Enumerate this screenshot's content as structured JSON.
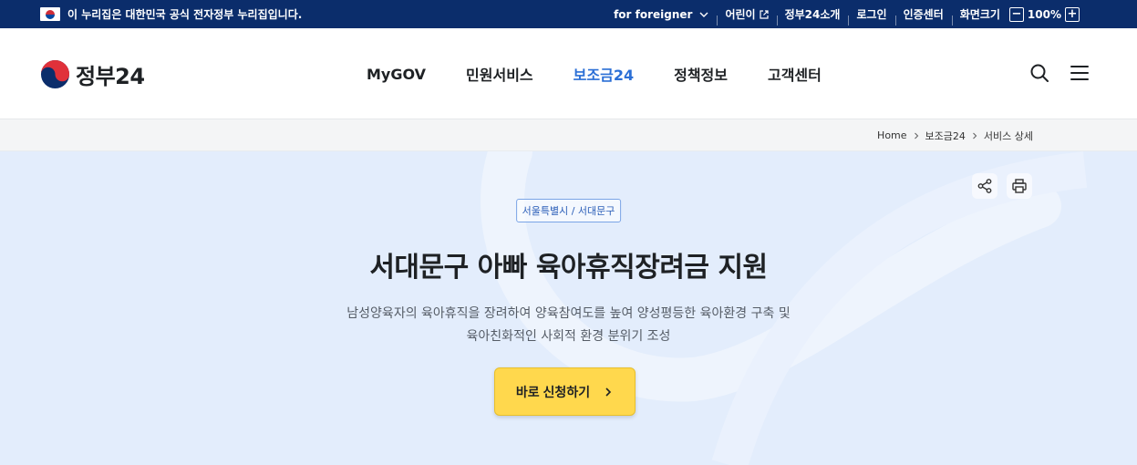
{
  "gov_banner": {
    "notice": "이 누리집은 대한민국 공식 전자정부 누리집입니다.",
    "foreigner": "for foreigner",
    "kids": "어린이",
    "about": "정부24소개",
    "login": "로그인",
    "cert": "인증센터",
    "zoom_label": "화면크기",
    "zoom_minus": "−",
    "zoom_value": "100%",
    "zoom_plus": "+"
  },
  "header": {
    "logo_text": "정부24",
    "nav": [
      {
        "label": "MyGOV"
      },
      {
        "label": "민원서비스"
      },
      {
        "label": "보조금24",
        "active": true
      },
      {
        "label": "정책정보"
      },
      {
        "label": "고객센터"
      }
    ],
    "icons": [
      "search-icon",
      "menu-icon"
    ]
  },
  "breadcrumb": [
    "Home",
    "보조금24",
    "서비스 상세"
  ],
  "hero": {
    "region": "서울특별시 / 서대문구",
    "title": "서대문구 아빠 육아휴직장려금 지원",
    "desc_line1": "남성양육자의 육아휴직을 장려하여 양육참여도를 높여 양성평등한 육아환경 구축 및",
    "desc_line2": "육아친화적인 사회적 환경 분위기 조성",
    "apply_label": "바로 신청하기",
    "tools": [
      "share-icon",
      "print-icon"
    ]
  },
  "colors": {
    "gov_bar": "#0b2d6b",
    "accent": "#2b6fd6",
    "hero_bg": "#e3edfc",
    "apply_btn": "#ffd84d"
  }
}
